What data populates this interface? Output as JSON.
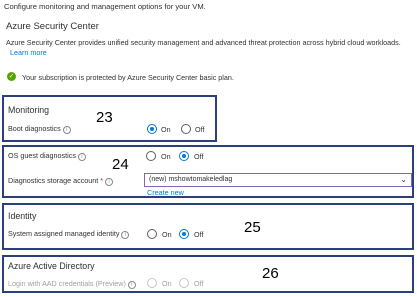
{
  "intro": "Configure monitoring and management options for your VM.",
  "security_center": {
    "title": "Azure Security Center",
    "description": "Azure Security Center provides unified security management and advanced threat protection across hybrid cloud workloads.",
    "learn_more": "Learn more",
    "status": "Your subscription is protected by Azure Security Center basic plan."
  },
  "monitoring": {
    "heading": "Monitoring",
    "boot_label": "Boot diagnostics",
    "boot_value": "On",
    "number": "23"
  },
  "guest": {
    "os_label": "OS guest diagnostics",
    "os_value": "Off",
    "storage_label": "Diagnostics storage account",
    "storage_value": "(new) mshowtomakeledlag",
    "create_new": "Create new",
    "number": "24"
  },
  "identity": {
    "heading": "Identity",
    "label": "System assigned managed identity",
    "value": "Off",
    "number": "25"
  },
  "aad": {
    "heading": "Azure Active Directory",
    "label": "Login with AAD credentials (Preview)",
    "value": "Off",
    "disabled": true,
    "number": "26"
  },
  "options": {
    "on": "On",
    "off": "Off"
  },
  "info_glyph": "i",
  "required_mark": "*",
  "colors": {
    "accent": "#0078d4",
    "box_border": "#2a3f7c",
    "success": "#57a300",
    "select_border": "#8764b8"
  }
}
